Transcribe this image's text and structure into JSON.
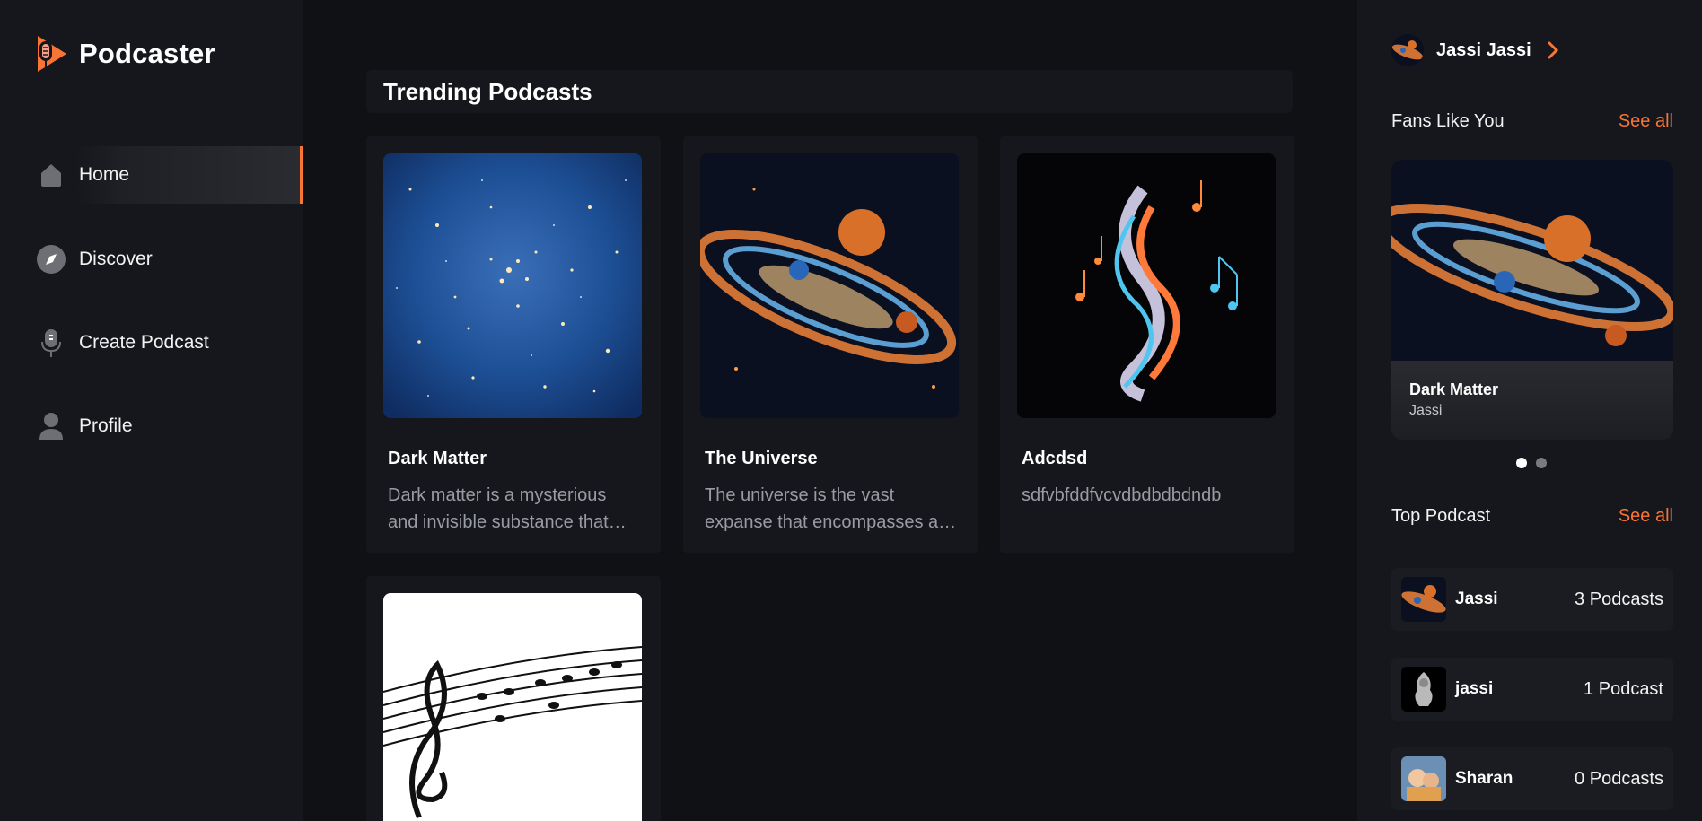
{
  "app": {
    "name": "Podcaster"
  },
  "sidebar": {
    "items": [
      {
        "label": "Home",
        "icon": "home-icon",
        "active": true
      },
      {
        "label": "Discover",
        "icon": "compass-icon",
        "active": false
      },
      {
        "label": "Create Podcast",
        "icon": "microphone-icon",
        "active": false
      },
      {
        "label": "Profile",
        "icon": "user-icon",
        "active": false
      }
    ]
  },
  "main": {
    "title": "Trending Podcasts",
    "podcasts": [
      {
        "title": "Dark Matter",
        "description": "Dark matter is a mysterious and invisible substance that makes up most of the universe",
        "cover": "starfield"
      },
      {
        "title": "The Universe",
        "description": "The universe is the vast expanse that encompasses all of space and time",
        "cover": "galaxy"
      },
      {
        "title": "Adcdsd",
        "description": "sdfvbfddfvcvdbdbdbdndb",
        "cover": "music-swirl"
      },
      {
        "title": "",
        "description": "",
        "cover": "music-notes"
      }
    ]
  },
  "right": {
    "user": {
      "name": "Jassi Jassi"
    },
    "fans": {
      "title": "Fans Like You",
      "see_all": "See all",
      "card": {
        "title": "Dark Matter",
        "author": "Jassi"
      },
      "slides": 2,
      "active_slide": 1
    },
    "top": {
      "title": "Top Podcast",
      "see_all": "See all",
      "items": [
        {
          "name": "Jassi",
          "count": "3 Podcasts"
        },
        {
          "name": "jassi",
          "count": "1 Podcast"
        },
        {
          "name": "Sharan",
          "count": "0 Podcasts"
        }
      ]
    }
  },
  "colors": {
    "accent": "#f97535",
    "background": "#101114",
    "panel": "#15171c"
  }
}
